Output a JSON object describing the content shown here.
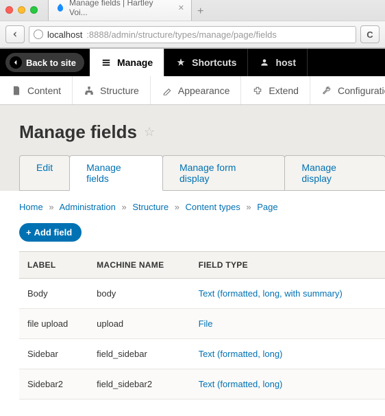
{
  "browser": {
    "tab_title": "Manage fields | Hartley Voi...",
    "url_host": "localhost",
    "url_path": ":8888/admin/structure/types/manage/page/fields"
  },
  "toolbar": {
    "back_label": "Back to site",
    "manage_label": "Manage",
    "shortcuts_label": "Shortcuts",
    "user_label": "host"
  },
  "subnav": {
    "content": "Content",
    "structure": "Structure",
    "appearance": "Appearance",
    "extend": "Extend",
    "configuration": "Configuration"
  },
  "page_title": "Manage fields",
  "tabs": {
    "edit": "Edit",
    "manage_fields": "Manage fields",
    "manage_form": "Manage form display",
    "manage_display": "Manage display"
  },
  "breadcrumb": {
    "home": "Home",
    "admin": "Administration",
    "structure": "Structure",
    "types": "Content types",
    "page": "Page"
  },
  "add_field_label": "Add field",
  "table": {
    "headers": {
      "label": "LABEL",
      "machine": "MACHINE NAME",
      "type": "FIELD TYPE"
    },
    "rows": [
      {
        "label": "Body",
        "machine": "body",
        "type": "Text (formatted, long, with summary)"
      },
      {
        "label": "file upload",
        "machine": "upload",
        "type": "File"
      },
      {
        "label": "Sidebar",
        "machine": "field_sidebar",
        "type": "Text (formatted, long)"
      },
      {
        "label": "Sidebar2",
        "machine": "field_sidebar2",
        "type": "Text (formatted, long)"
      }
    ]
  }
}
